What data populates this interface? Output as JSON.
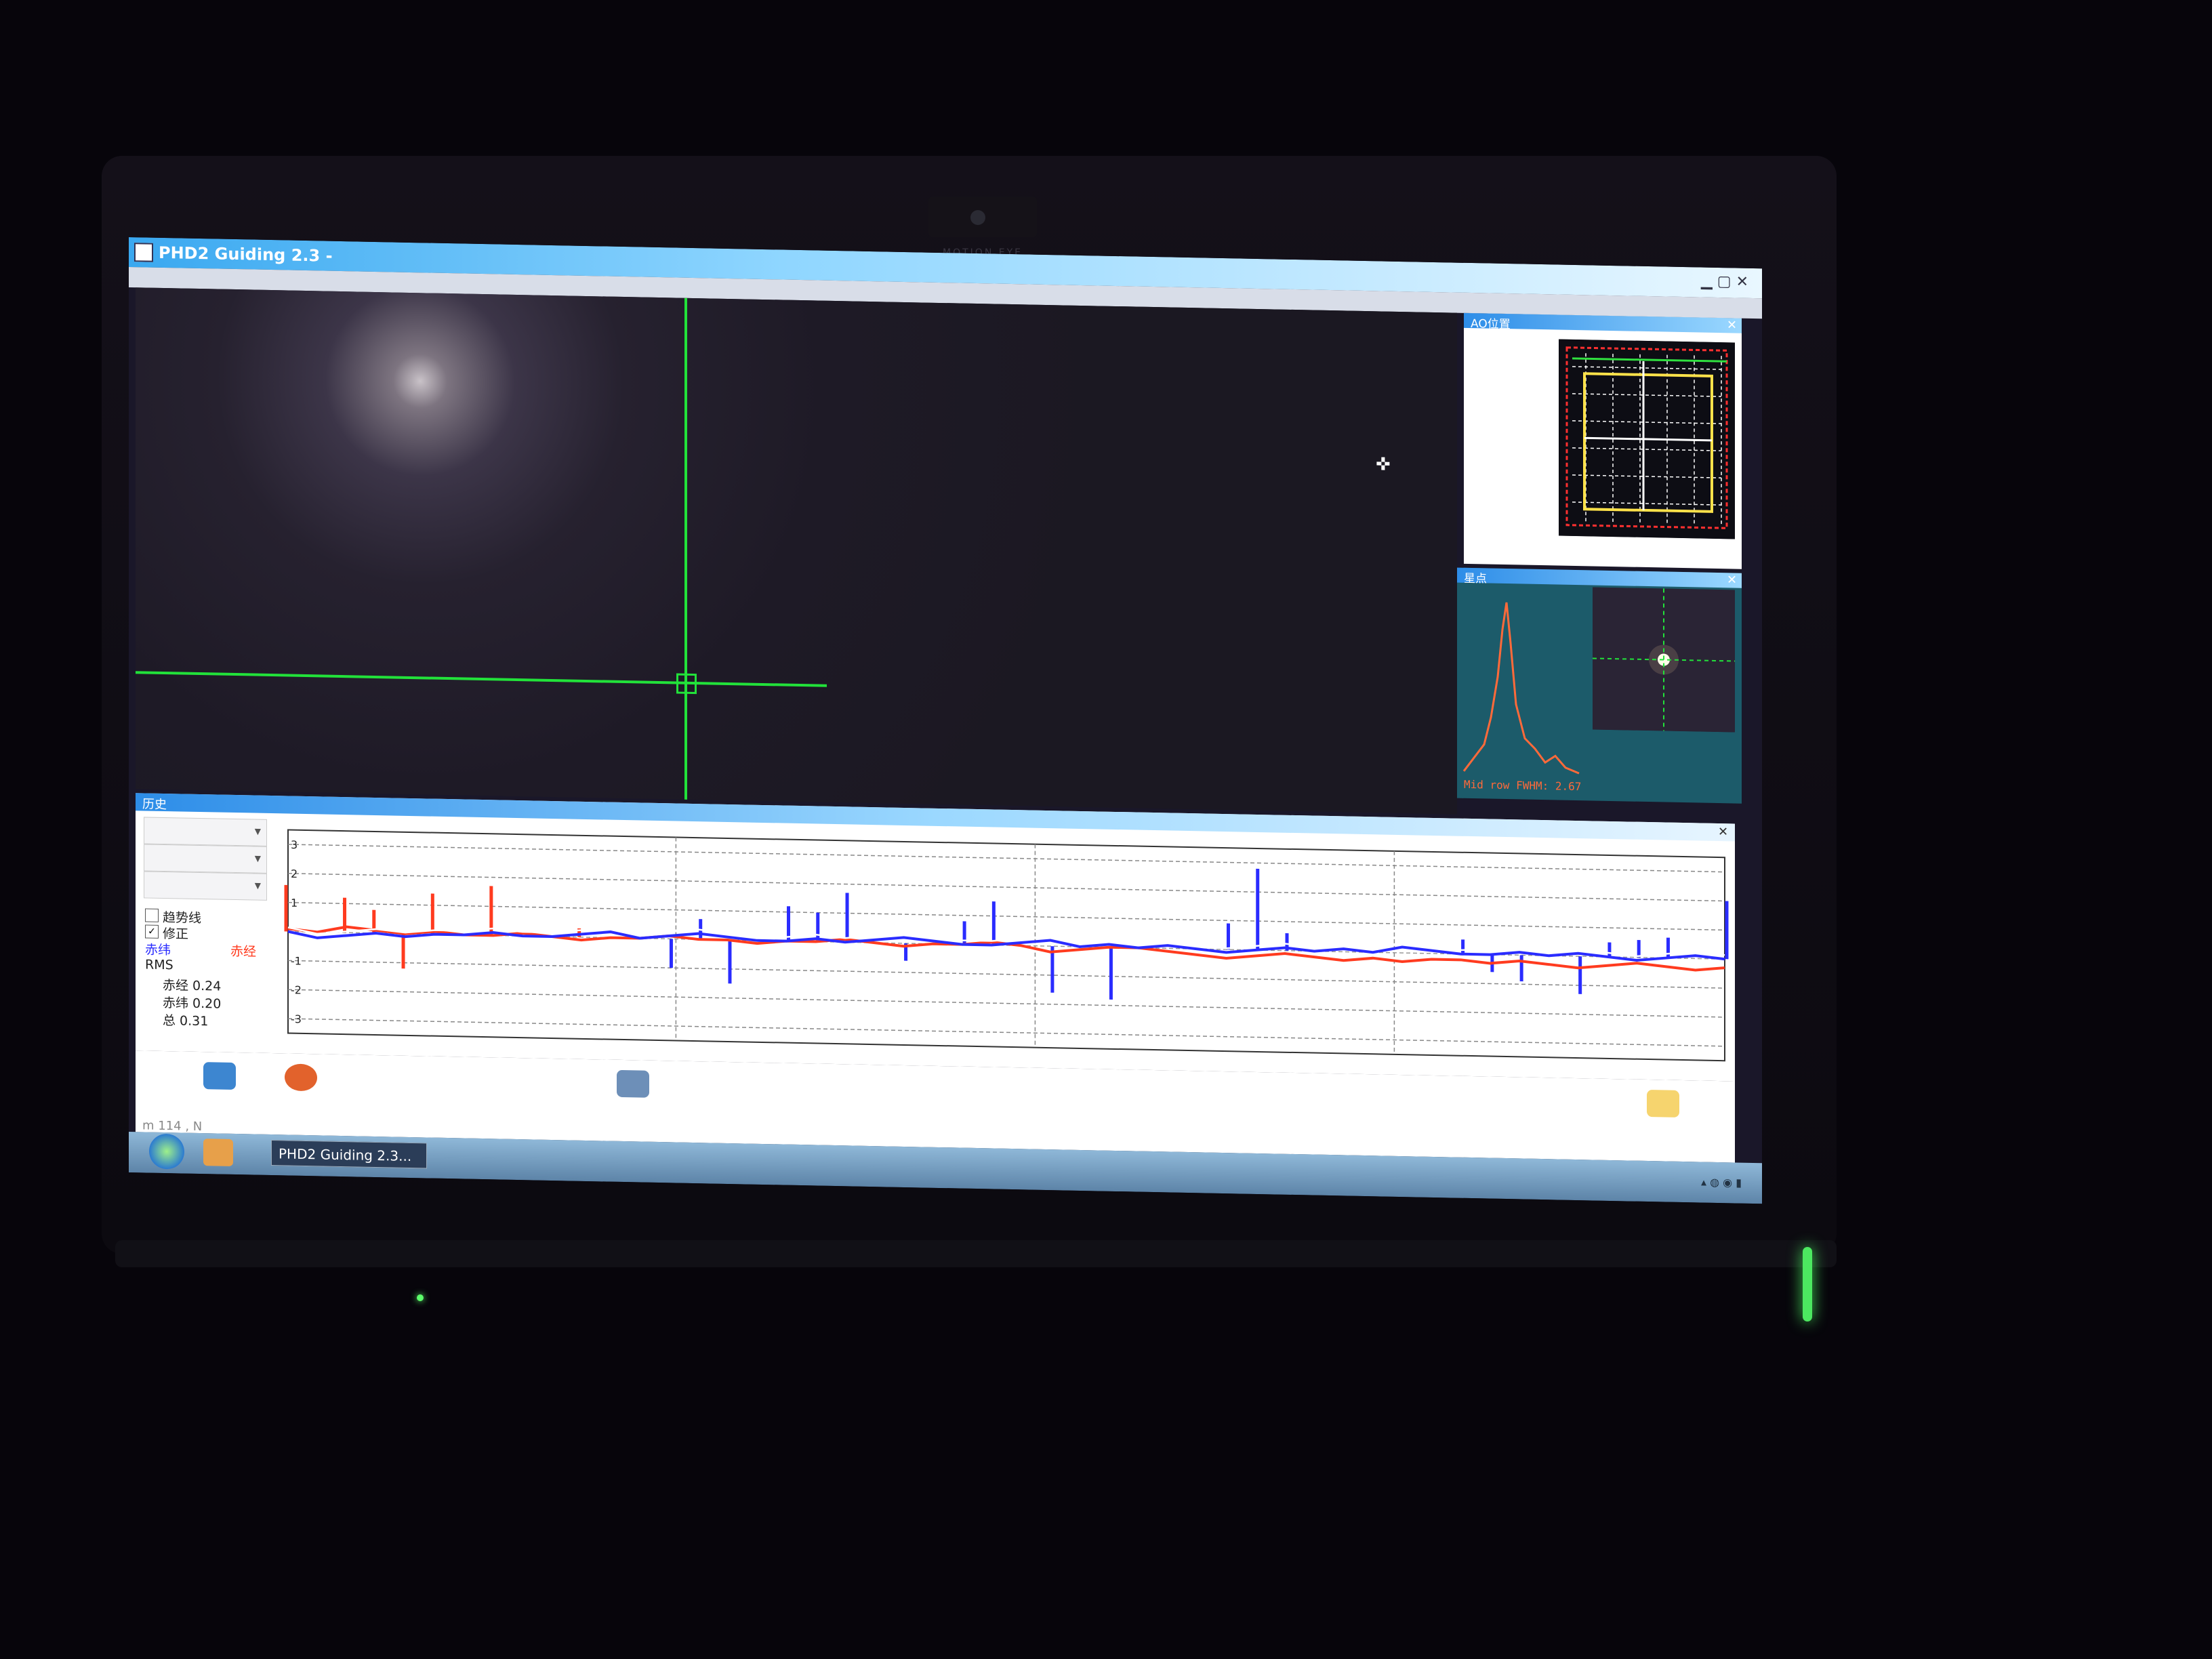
{
  "device": {
    "webcam_label": "MOTION EYE"
  },
  "window": {
    "title": "PHD2 Guiding 2.3 - ",
    "controls": "▁ ▢ ✕"
  },
  "ao_panel": {
    "title": "AO位置",
    "close": "✕"
  },
  "profile_panel": {
    "title": "星点",
    "close": "✕",
    "fwhm_label": "Mid row FWHM: 2.67"
  },
  "history": {
    "title": "历史",
    "close": "✕",
    "checkbox_trend": "趋势线",
    "checkbox_correction": "修正",
    "legend_ra": "赤经",
    "legend_dec": "赤纬",
    "rms_label": "RMS",
    "rms_ra": "赤经 0.24",
    "rms_dec": "赤纬 0.20",
    "rms_total": "总 0.31",
    "y_ticks": [
      "3",
      "2",
      "1",
      "-1",
      "-2",
      "-3"
    ]
  },
  "toolbar": {
    "status": "m 114 , N"
  },
  "taskbar": {
    "task_button": "PHD2 Guiding 2.3..."
  },
  "colors": {
    "crosshair": "#22e23a",
    "ra_line": "#ff3b1f",
    "dec_line": "#2a2cff",
    "trend": "#ffffff"
  },
  "chart_data": {
    "type": "line",
    "title": "",
    "xlabel": "",
    "ylabel": "",
    "ylim": [
      -3.5,
      3.5
    ],
    "series": [
      {
        "name": "赤经",
        "values": [
          0.1,
          0.0,
          0.2,
          0.1,
          0.0,
          0.1,
          0.0,
          0.0,
          0.1,
          0.0,
          -0.1,
          0.0,
          0.0,
          0.1,
          0.0,
          0.0,
          -0.1,
          0.0,
          0.0,
          0.1,
          0.0,
          -0.1,
          0.0,
          0.0,
          0.1,
          0.0,
          -0.2,
          -0.1,
          0.0,
          0.0,
          -0.1,
          -0.2,
          -0.3,
          -0.2,
          -0.1,
          -0.2,
          -0.3,
          -0.2,
          -0.3,
          -0.2,
          -0.2,
          -0.3,
          -0.2,
          -0.3,
          -0.4,
          -0.3,
          -0.2,
          -0.3,
          -0.4,
          -0.3
        ]
      },
      {
        "name": "赤纬",
        "values": [
          0.0,
          -0.2,
          -0.1,
          0.0,
          -0.1,
          0.0,
          0.0,
          0.1,
          0.0,
          0.0,
          0.1,
          0.2,
          0.0,
          0.1,
          0.2,
          0.1,
          0.0,
          0.0,
          0.1,
          0.0,
          0.1,
          0.2,
          0.1,
          0.0,
          0.0,
          0.1,
          0.2,
          0.0,
          0.1,
          0.0,
          0.1,
          0.0,
          -0.1,
          0.0,
          0.1,
          0.0,
          0.1,
          0.0,
          0.2,
          0.1,
          0.0,
          0.0,
          0.1,
          0.0,
          0.1,
          0.0,
          -0.1,
          0.0,
          0.1,
          0.0
        ]
      }
    ],
    "ra_corrections": [
      1.6,
      0.0,
      1.2,
      0.8,
      -1.2,
      1.4,
      0.0,
      1.7,
      0.0,
      0.0,
      0.3,
      0.0,
      0.0,
      0.0,
      0.0,
      0.0,
      0.0,
      0.0,
      0.0,
      0.0,
      0.0,
      0.0,
      0.0,
      0.0,
      0.0,
      0.0,
      0.0,
      0.0,
      0.0,
      0.0,
      0.0,
      0.0,
      0.0,
      0.0,
      0.0,
      0.0,
      0.0,
      0.0,
      0.0,
      0.0,
      0.0,
      0.0,
      0.0,
      0.0,
      0.0,
      0.0,
      0.0,
      0.0,
      0.0,
      0.0
    ],
    "dec_corrections": [
      0.0,
      0.0,
      0.0,
      0.0,
      0.0,
      0.0,
      0.0,
      0.0,
      0.0,
      0.0,
      0.0,
      0.0,
      0.0,
      -1.0,
      0.7,
      -1.5,
      0.0,
      1.2,
      1.0,
      1.7,
      0.0,
      -0.6,
      0.0,
      0.8,
      1.5,
      0.0,
      -1.6,
      0.0,
      -1.8,
      0.0,
      0.0,
      0.0,
      0.9,
      2.8,
      0.6,
      0.0,
      0.0,
      0.0,
      0.0,
      0.0,
      0.5,
      -0.6,
      -0.9,
      0.0,
      -1.3,
      0.5,
      0.6,
      0.7,
      0.0,
      2.0
    ]
  }
}
